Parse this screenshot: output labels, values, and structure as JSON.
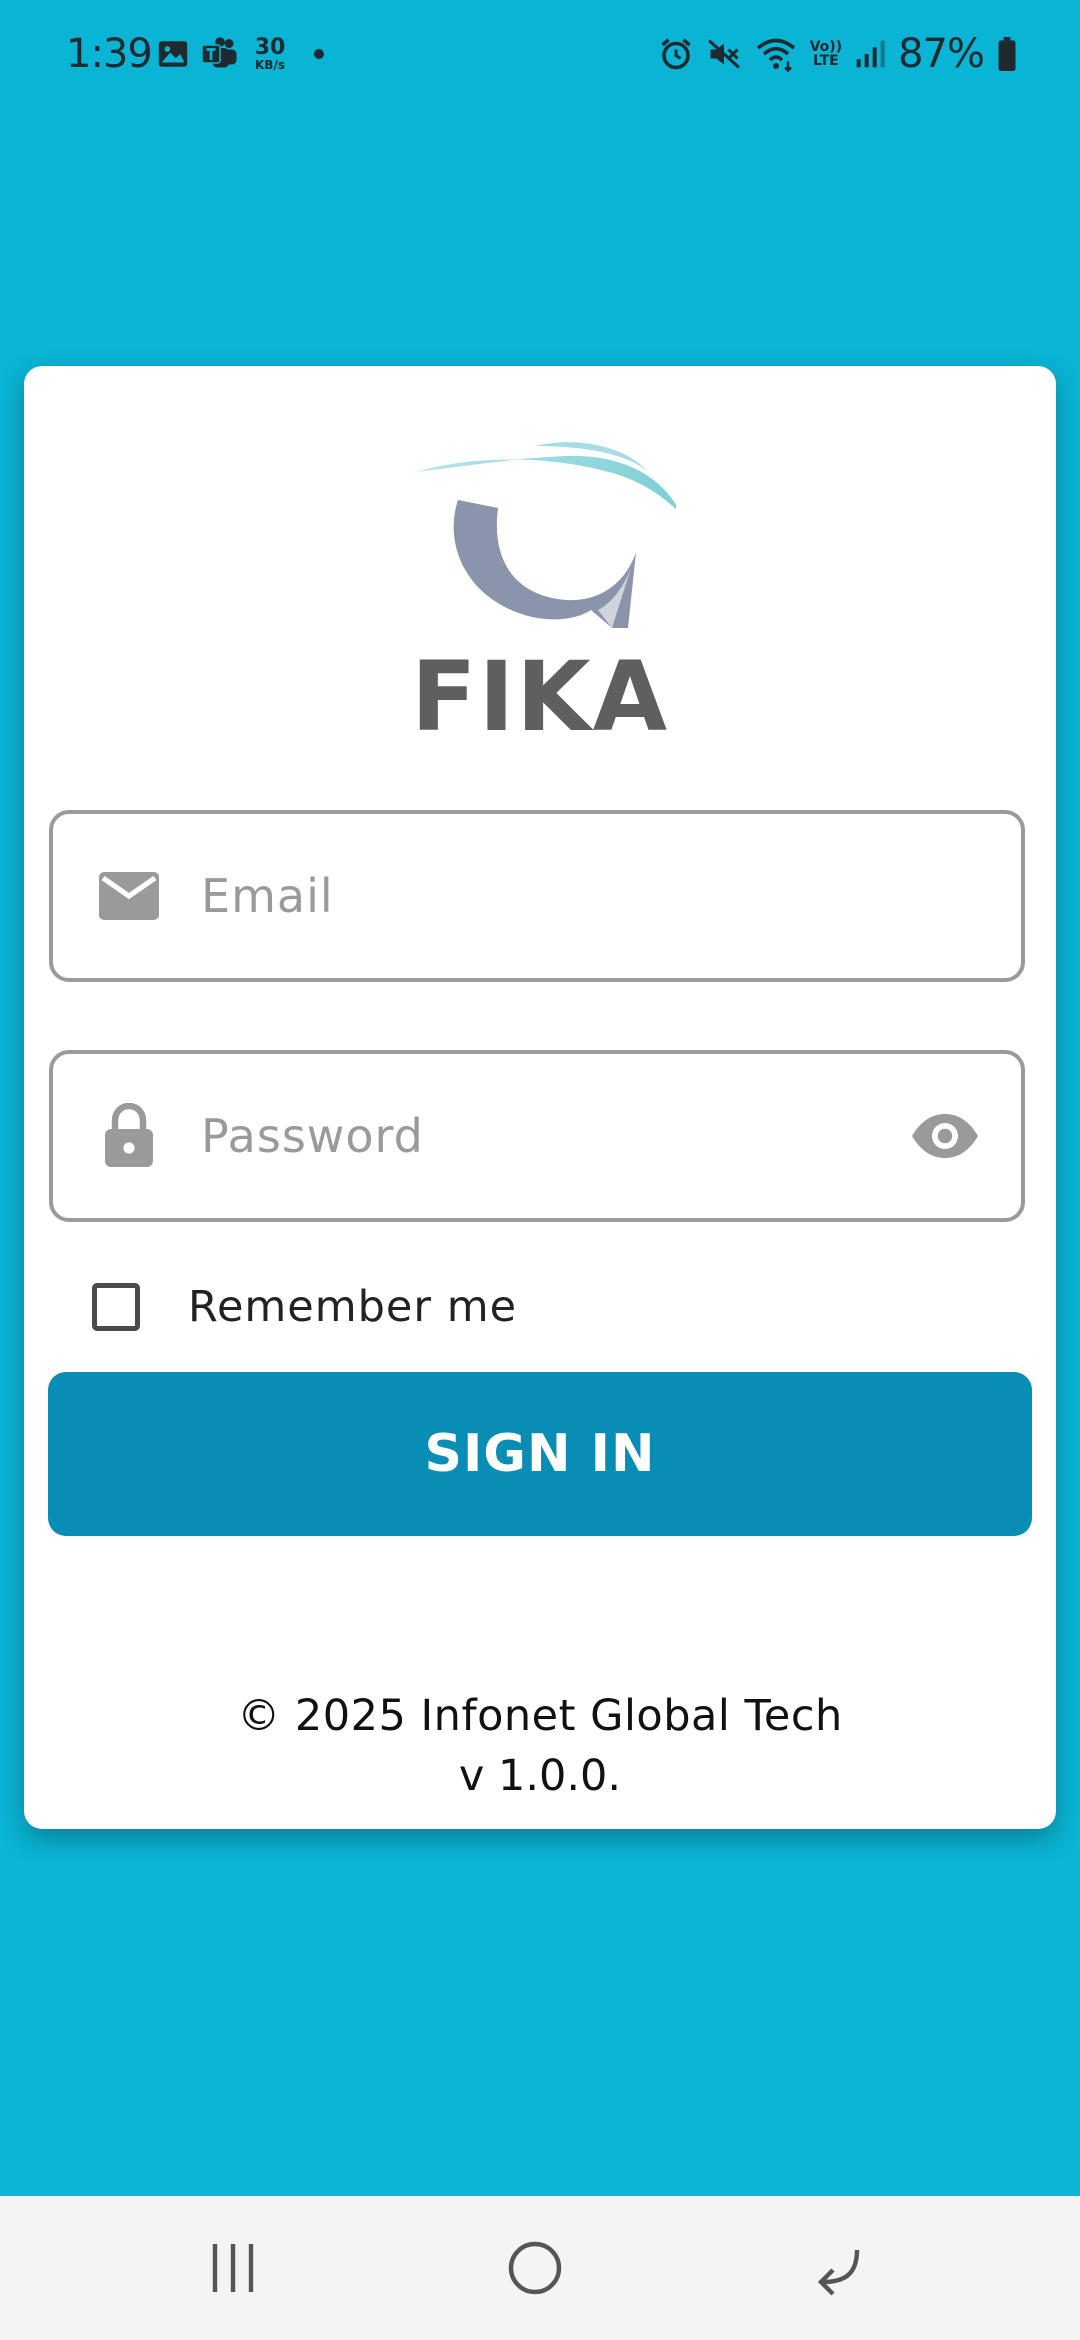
{
  "status_bar": {
    "time": "1:39",
    "speed_value": "30",
    "speed_unit": "KB/s",
    "volte_top": "Vo))",
    "volte_bottom": "LTE",
    "battery": "87%"
  },
  "app": {
    "title": "FIKA"
  },
  "form": {
    "email_placeholder": "Email",
    "password_placeholder": "Password",
    "remember_label": "Remember me",
    "remember_checked": false,
    "signin_label": "SIGN IN"
  },
  "footer": {
    "copyright": "© 2025 Infonet Global Tech",
    "version": "v 1.0.0."
  },
  "colors": {
    "background": "#0ab4d4",
    "button": "#0a8db4",
    "title": "#5f5f5f",
    "field_border": "#9a9a9a"
  },
  "icons": {
    "email": "mail-icon",
    "password": "lock-icon",
    "toggle": "eye-icon",
    "nav": [
      "recents-icon",
      "home-icon",
      "back-icon"
    ]
  }
}
